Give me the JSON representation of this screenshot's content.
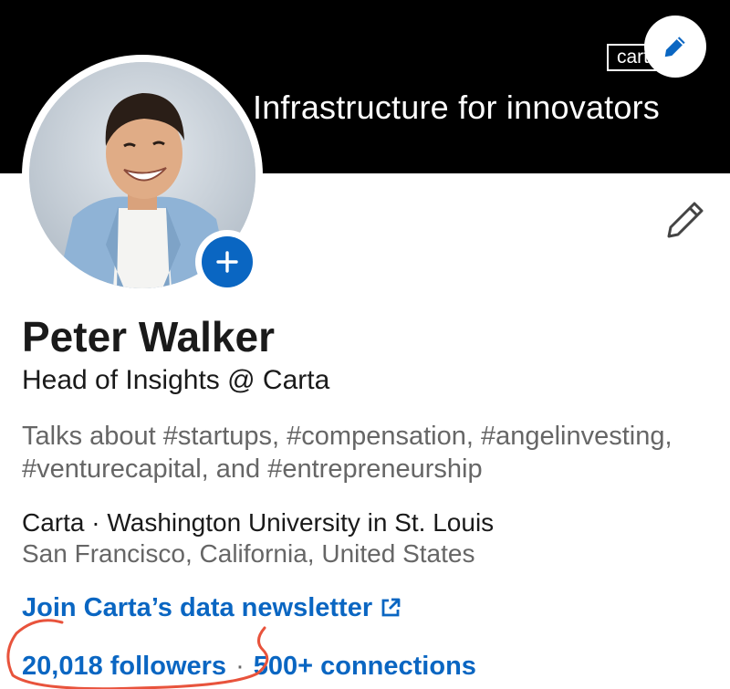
{
  "banner": {
    "logo_text": "cart",
    "tagline": "Infrastructure for innovators",
    "background": "#000000"
  },
  "icons": {
    "banner_edit": "pencil-icon",
    "intro_edit": "pencil-outline-icon",
    "add_photo": "plus-icon",
    "external_link": "external-link-icon"
  },
  "profile": {
    "name": "Peter Walker",
    "headline": "Head of Insights @ Carta",
    "talks_about": "Talks about #startups, #compensation, #angelinvesting, #venturecapital, and #entrepreneurship",
    "company_line": "Carta · Washington University in St. Louis",
    "location": "San Francisco, California, United States",
    "newsletter_link": "Join Carta’s data newsletter",
    "followers": "20,018 followers",
    "separator": "·",
    "connections": "500+ connections"
  },
  "colors": {
    "accent": "#0a66c2",
    "annotation": "#e8533c",
    "muted_text": "#666666"
  }
}
